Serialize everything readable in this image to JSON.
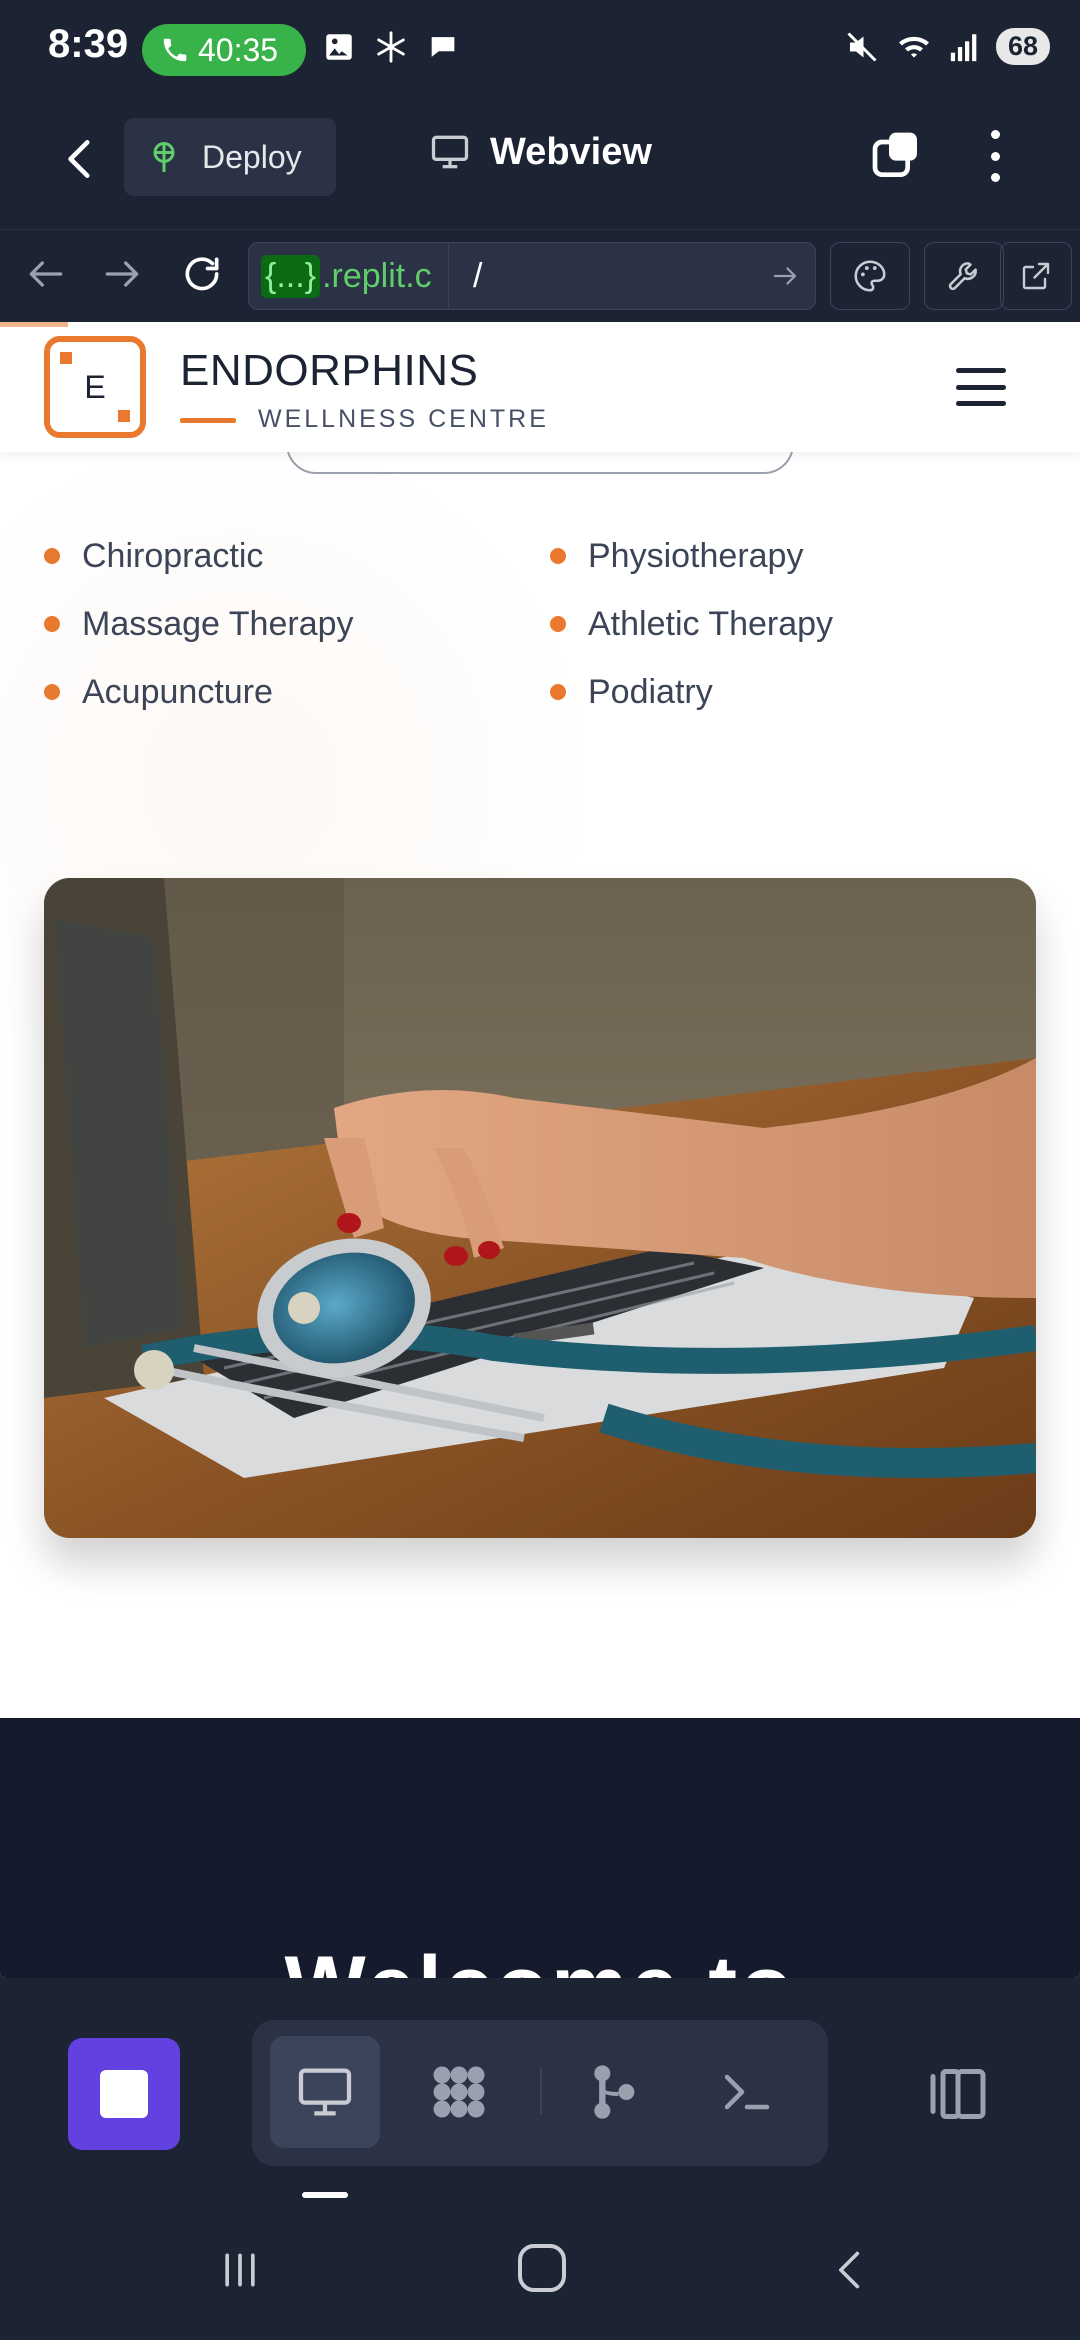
{
  "status_bar": {
    "time": "8:39",
    "call_duration": "40:35",
    "battery": "68"
  },
  "top_bar": {
    "deploy_label": "Deploy",
    "webview_title": "Webview"
  },
  "browser_bar": {
    "url_host_braces": "{...}",
    "url_host_rest": ".replit.c",
    "url_path": "/"
  },
  "site": {
    "logo_letter": "E",
    "brand_name": "ENDORPHINS",
    "brand_sub": "WELLNESS CENTRE",
    "services": [
      "Chiropractic",
      "Physiotherapy",
      "Massage Therapy",
      "Athletic Therapy",
      "Acupuncture",
      "Podiatry"
    ],
    "section_title_partial": "Welcome to"
  },
  "colors": {
    "accent": "#e8792e",
    "app_bg": "#1c2333",
    "run_button": "#6341e0",
    "call_pill": "#38b34a",
    "url_host": "#5fcd6a"
  },
  "icons": {
    "back": "chevron-left-icon",
    "deploy": "deploy-icon",
    "monitor": "monitor-icon",
    "tabs": "tabs-icon",
    "kebab": "more-vert-icon",
    "nav_back": "arrow-left-icon",
    "nav_forward": "arrow-right-icon",
    "reload": "reload-icon",
    "go": "arrow-right-icon",
    "palette": "palette-icon",
    "devtools": "wrench-icon",
    "external": "external-link-icon",
    "stop": "stop-icon",
    "preview": "monitor-icon",
    "dev_tools": "dots-grid-icon",
    "git": "git-branch-icon",
    "shell": "terminal-icon",
    "split": "split-view-icon"
  }
}
